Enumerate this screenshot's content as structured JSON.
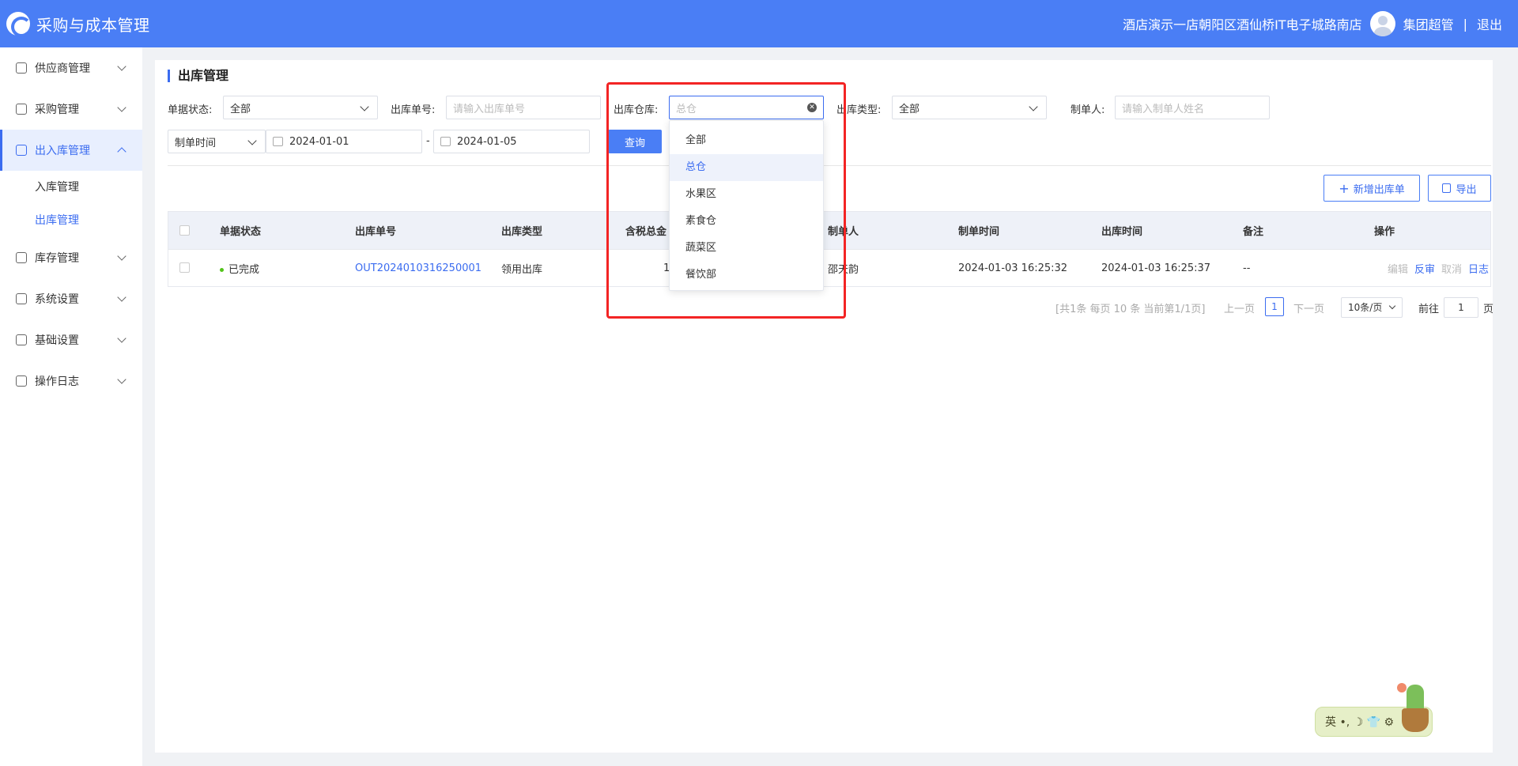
{
  "app": {
    "title": "采购与成本管理"
  },
  "header": {
    "store": "酒店演示一店朝阳区酒仙桥IT电子城路南店",
    "user": "集团超管",
    "separator": "|",
    "logout": "退出"
  },
  "sidebar": {
    "menu": [
      {
        "label": "供应商管理",
        "icon": "supplier-icon"
      },
      {
        "label": "采购管理",
        "icon": "purchase-icon"
      },
      {
        "label": "出入库管理",
        "icon": "inout-icon",
        "active": true
      },
      {
        "label": "库存管理",
        "icon": "inventory-icon"
      },
      {
        "label": "系统设置",
        "icon": "system-icon"
      },
      {
        "label": "基础设置",
        "icon": "gear-icon"
      },
      {
        "label": "操作日志",
        "icon": "log-icon"
      }
    ],
    "submenu": [
      {
        "label": "入库管理"
      },
      {
        "label": "出库管理",
        "active": true
      }
    ]
  },
  "page": {
    "title": "出库管理"
  },
  "filters": {
    "status_label": "单据状态:",
    "status_value": "全部",
    "order_no_label": "出库单号:",
    "order_no_placeholder": "请输入出库单号",
    "warehouse_label": "出库仓库:",
    "warehouse_placeholder": "总仓",
    "type_label": "出库类型:",
    "type_value": "全部",
    "creator_label": "制单人:",
    "creator_placeholder": "请输入制单人姓名",
    "time_type": "制单时间",
    "date_from": "2024-01-01",
    "date_sep": "-",
    "date_to": "2024-01-05",
    "query": "查询"
  },
  "actions": {
    "add": "新增出库单",
    "add_icon": "plus-icon",
    "export": "导出",
    "export_icon": "save-icon"
  },
  "table": {
    "headers": [
      "单据状态",
      "出库单号",
      "出库类型",
      "含税总金",
      "制单人",
      "制单时间",
      "出库时间",
      "备注",
      "操作"
    ],
    "rows": [
      {
        "status": "已完成",
        "order_no": "OUT2024010316250001",
        "type": "领用出库",
        "amount": "1",
        "creator": "邵天韵",
        "created": "2024-01-03 16:25:32",
        "out_time": "2024-01-03 16:25:37",
        "note": "--",
        "ops": [
          "编辑",
          "反审",
          "取消",
          "日志"
        ]
      }
    ]
  },
  "pagination": {
    "summary": "[共1条 每页 10 条 当前第1/1页]",
    "prev": "上一页",
    "page": "1",
    "next": "下一页",
    "size": "10条/页",
    "goto_label": "前往",
    "goto_value": "1",
    "goto_suffix": "页"
  },
  "warehouse_dropdown": {
    "options": [
      "全部",
      "总仓",
      "水果区",
      "素食仓",
      "蔬菜区",
      "餐饮部"
    ],
    "selected": "总仓"
  },
  "ime": {
    "label": "英 •, ☽ 👕 ⚙"
  },
  "colors": {
    "primary": "#4a7ef5",
    "highlight": "#f32424",
    "success": "#52c41a"
  }
}
